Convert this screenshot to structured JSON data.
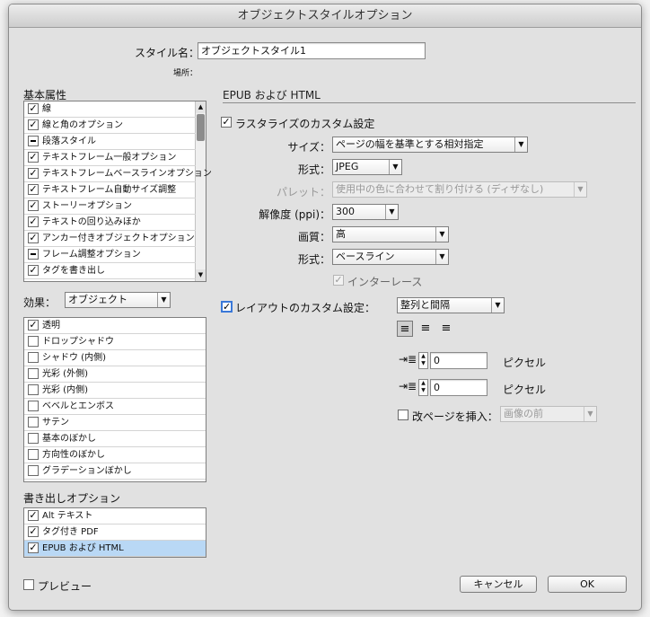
{
  "window": {
    "title": "オブジェクトスタイルオプション"
  },
  "style_name": {
    "label": "スタイル名：",
    "value": "オブジェクトスタイル1"
  },
  "location_label": "場所：",
  "basic_attributes": {
    "header": "基本属性",
    "items": [
      {
        "label": "線",
        "state": "checked"
      },
      {
        "label": "線と角のオプション",
        "state": "checked"
      },
      {
        "label": "段落スタイル",
        "state": "mixed"
      },
      {
        "label": "テキストフレーム一般オプション",
        "state": "checked"
      },
      {
        "label": "テキストフレームベースラインオプション",
        "state": "checked"
      },
      {
        "label": "テキストフレーム自動サイズ調整",
        "state": "checked"
      },
      {
        "label": "ストーリーオプション",
        "state": "checked"
      },
      {
        "label": "テキストの回り込みほか",
        "state": "checked"
      },
      {
        "label": "アンカー付きオブジェクトオプション",
        "state": "checked"
      },
      {
        "label": "フレーム調整オプション",
        "state": "mixed"
      },
      {
        "label": "タグを書き出し",
        "state": "checked"
      }
    ]
  },
  "effects": {
    "label": "効果：",
    "selected": "オブジェクト",
    "items": [
      {
        "label": "透明",
        "checked": true
      },
      {
        "label": "ドロップシャドウ",
        "checked": false
      },
      {
        "label": "シャドウ (内側)",
        "checked": false
      },
      {
        "label": "光彩 (外側)",
        "checked": false
      },
      {
        "label": "光彩 (内側)",
        "checked": false
      },
      {
        "label": "ベベルとエンボス",
        "checked": false
      },
      {
        "label": "サテン",
        "checked": false
      },
      {
        "label": "基本のぼかし",
        "checked": false
      },
      {
        "label": "方向性のぼかし",
        "checked": false
      },
      {
        "label": "グラデーションぼかし",
        "checked": false
      }
    ]
  },
  "export_options": {
    "header": "書き出しオプション",
    "items": [
      {
        "label": "Alt テキスト",
        "checked": true
      },
      {
        "label": "タグ付き PDF",
        "checked": true
      },
      {
        "label": "EPUB および HTML",
        "checked": true,
        "selected": true
      }
    ]
  },
  "section_title": "EPUB および HTML",
  "rasterize": {
    "label": "ラスタライズのカスタム設定",
    "checked": true
  },
  "size": {
    "label": "サイズ：",
    "value": "ページの幅を基準とする相対指定"
  },
  "format": {
    "label": "形式：",
    "value": "JPEG"
  },
  "palette": {
    "label": "パレット：",
    "value": "使用中の色に合わせて割り付ける (ディザなし)"
  },
  "resolution": {
    "label": "解像度 (ppi)：",
    "value": "300"
  },
  "quality": {
    "label": "画質：",
    "value": "高"
  },
  "method": {
    "label": "形式：",
    "value": "ベースライン"
  },
  "interlace": {
    "label": "インターレース",
    "checked": true
  },
  "layout": {
    "label": "レイアウトのカスタム設定：",
    "checked": true,
    "value": "整列と間隔"
  },
  "align_icons": [
    "align-left-icon",
    "align-center-icon",
    "align-right-icon"
  ],
  "space_before": {
    "value": "0",
    "unit": "ピクセル"
  },
  "space_after": {
    "value": "0",
    "unit": "ピクセル"
  },
  "page_break": {
    "label": "改ページを挿入：",
    "checked": false,
    "value": "画像の前"
  },
  "preview": {
    "label": "プレビュー",
    "checked": false
  },
  "buttons": {
    "cancel": "キャンセル",
    "ok": "OK"
  }
}
